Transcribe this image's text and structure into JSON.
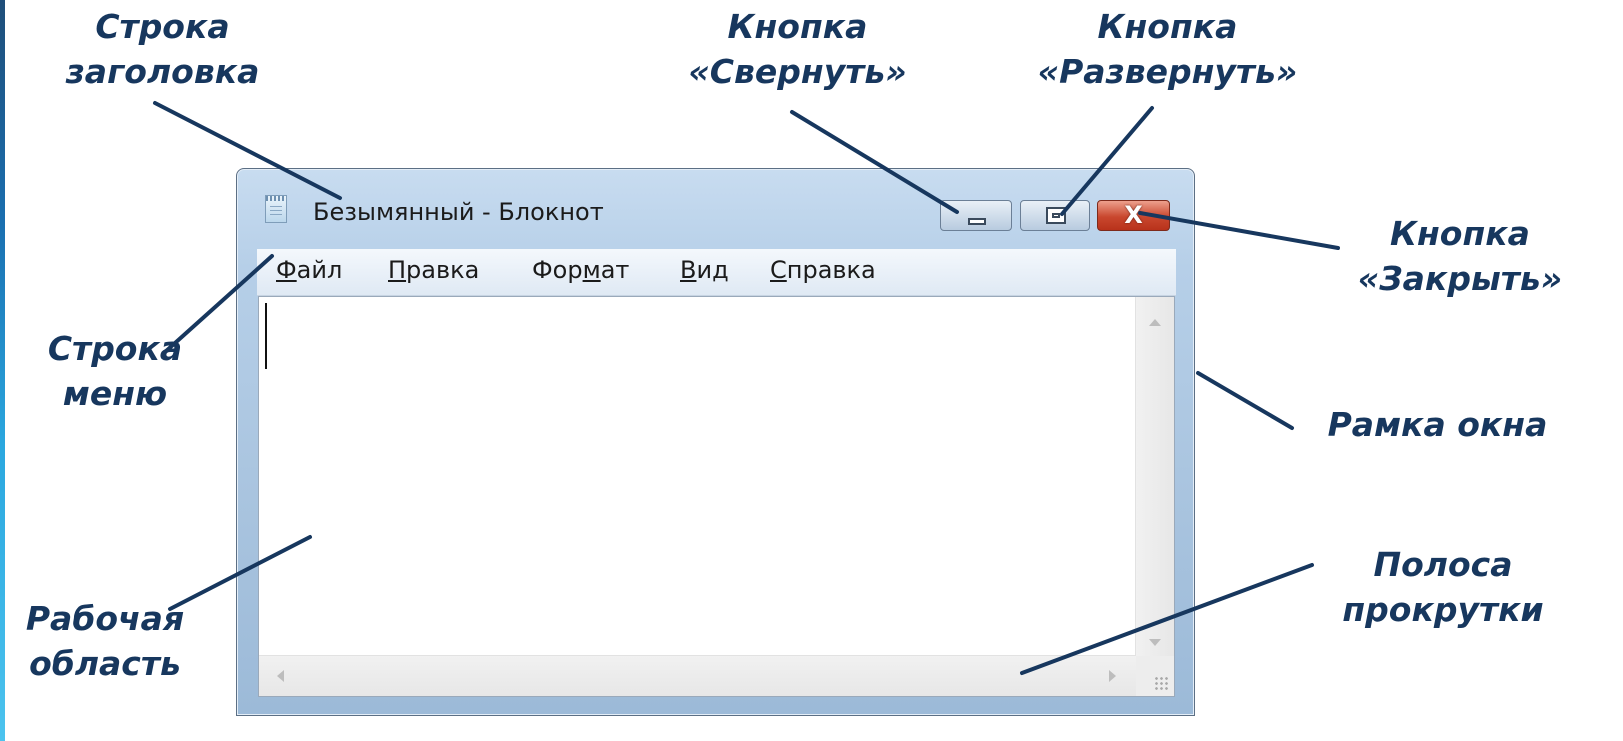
{
  "window": {
    "title": "Безымянный - Блокнот",
    "close_glyph": "X",
    "menu": [
      {
        "hotkey": "Ф",
        "rest": "айл",
        "before": ""
      },
      {
        "hotkey": "П",
        "rest": "равка",
        "before": ""
      },
      {
        "hotkey": "м",
        "rest": "ат",
        "before": "Фор"
      },
      {
        "hotkey": "В",
        "rest": "ид",
        "before": ""
      },
      {
        "hotkey": "С",
        "rest": "правка",
        "before": ""
      }
    ]
  },
  "callouts": {
    "title_bar": [
      "Строка",
      "заголовка"
    ],
    "minimize": [
      "Кнопка",
      "«Свернуть»"
    ],
    "maximize": [
      "Кнопка",
      "«Развернуть»"
    ],
    "close": [
      "Кнопка",
      "«Закрыть»"
    ],
    "menu_bar": [
      "Строка",
      "меню"
    ],
    "frame": [
      "Рамка окна"
    ],
    "workspace": [
      "Рабочая",
      "область"
    ],
    "scrollbar": [
      "Полоса",
      "прокрутки"
    ]
  },
  "colors": {
    "callout_text": "#17375e",
    "leader_line": "#17375e",
    "close_button": "#c9472e",
    "window_frame": "#b6cfe8"
  }
}
